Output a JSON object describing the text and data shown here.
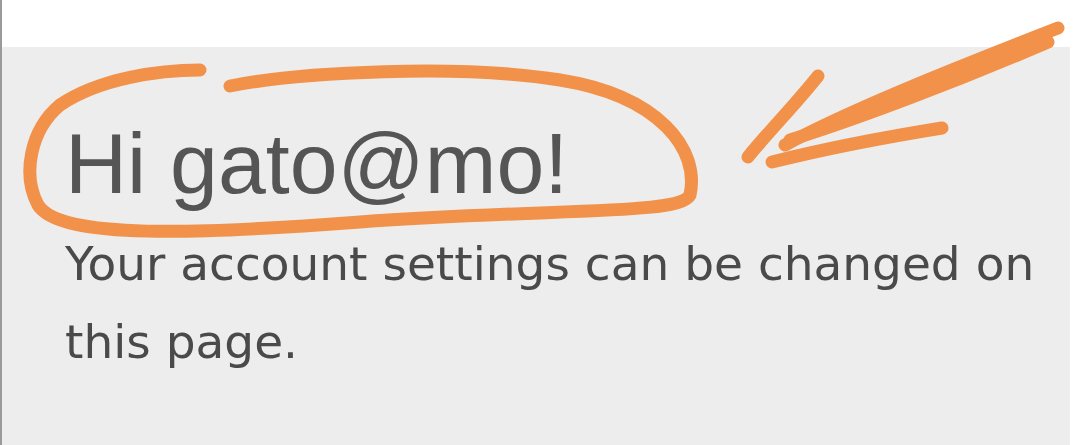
{
  "greeting": {
    "heading": "Hi gato@mo!",
    "text": "Your account settings can be changed on this page."
  }
}
